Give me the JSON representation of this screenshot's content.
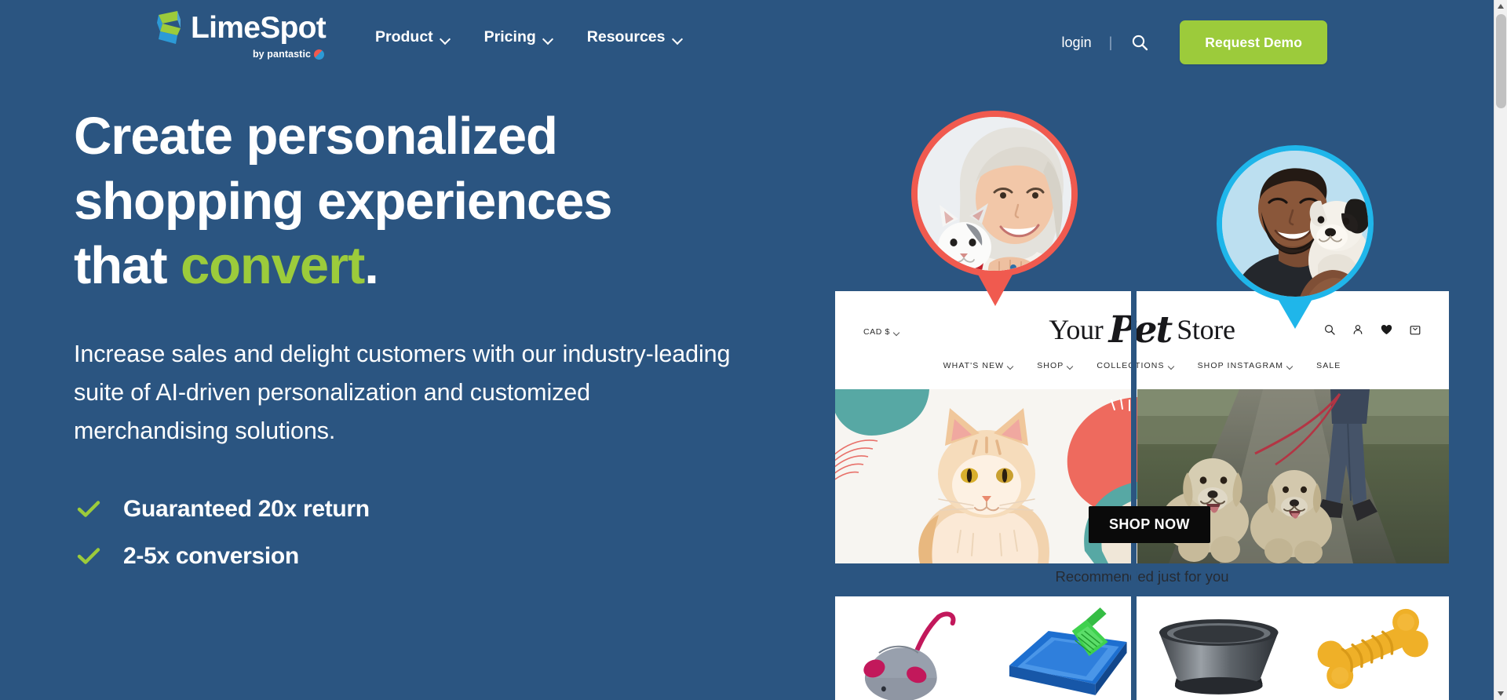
{
  "brand": {
    "name": "LimeSpot",
    "tagline": "by pantastic",
    "logo_icon": "limespot-logo-icon",
    "accent_green": "#9ccb3b",
    "background_blue": "#2b5581"
  },
  "header": {
    "nav": [
      {
        "label": "Product",
        "has_dropdown": true
      },
      {
        "label": "Pricing",
        "has_dropdown": true
      },
      {
        "label": "Resources",
        "has_dropdown": true
      }
    ],
    "login_label": "login",
    "separator": "|",
    "search_icon": "search-icon",
    "cta_label": "Request Demo"
  },
  "hero": {
    "headline_line1": "Create personalized",
    "headline_line2": "shopping experiences",
    "headline_line3_pre": "that ",
    "headline_line3_accent": "convert",
    "headline_line3_post": ".",
    "subhead": "Increase sales and delight customers with our industry-leading suite of AI-driven personalization and customized merchandising solutions.",
    "bullets": [
      {
        "icon": "check-icon",
        "label": "Guaranteed 20x return"
      },
      {
        "icon": "check-icon",
        "label": "2-5x conversion"
      }
    ]
  },
  "mockup": {
    "avatars": [
      {
        "name": "avatar-woman-with-cat",
        "border_color": "#f05a4f"
      },
      {
        "name": "avatar-man-with-dog",
        "border_color": "#1fb6ea"
      }
    ],
    "store": {
      "currency_label": "CAD $",
      "title_part1": "Your",
      "title_script": "Pet",
      "title_part2": "Store",
      "nav": [
        {
          "label": "WHAT'S NEW",
          "has_dropdown": true
        },
        {
          "label": "SHOP",
          "has_dropdown": true
        },
        {
          "label": "COLLECTIONS",
          "has_dropdown": true
        },
        {
          "label": "SHOP INSTAGRAM",
          "has_dropdown": true
        },
        {
          "label": "SALE",
          "has_dropdown": false
        }
      ],
      "icons": [
        {
          "name": "store-search-icon"
        },
        {
          "name": "store-account-icon"
        },
        {
          "name": "store-wishlist-heart-icon"
        },
        {
          "name": "store-cart-bag-icon"
        }
      ],
      "banner_cta": "SHOP NOW",
      "recommendation_heading": "Recommended just for you",
      "banner_images": [
        {
          "name": "banner-orange-cat"
        },
        {
          "name": "banner-two-dogs-walking"
        }
      ],
      "products": [
        {
          "name": "product-gray-toy-mouse"
        },
        {
          "name": "product-blue-litter-box"
        },
        {
          "name": "product-metal-pet-bowl"
        },
        {
          "name": "product-yellow-bone-toy"
        }
      ]
    }
  },
  "scrollbar": {
    "name": "vertical-scrollbar"
  }
}
